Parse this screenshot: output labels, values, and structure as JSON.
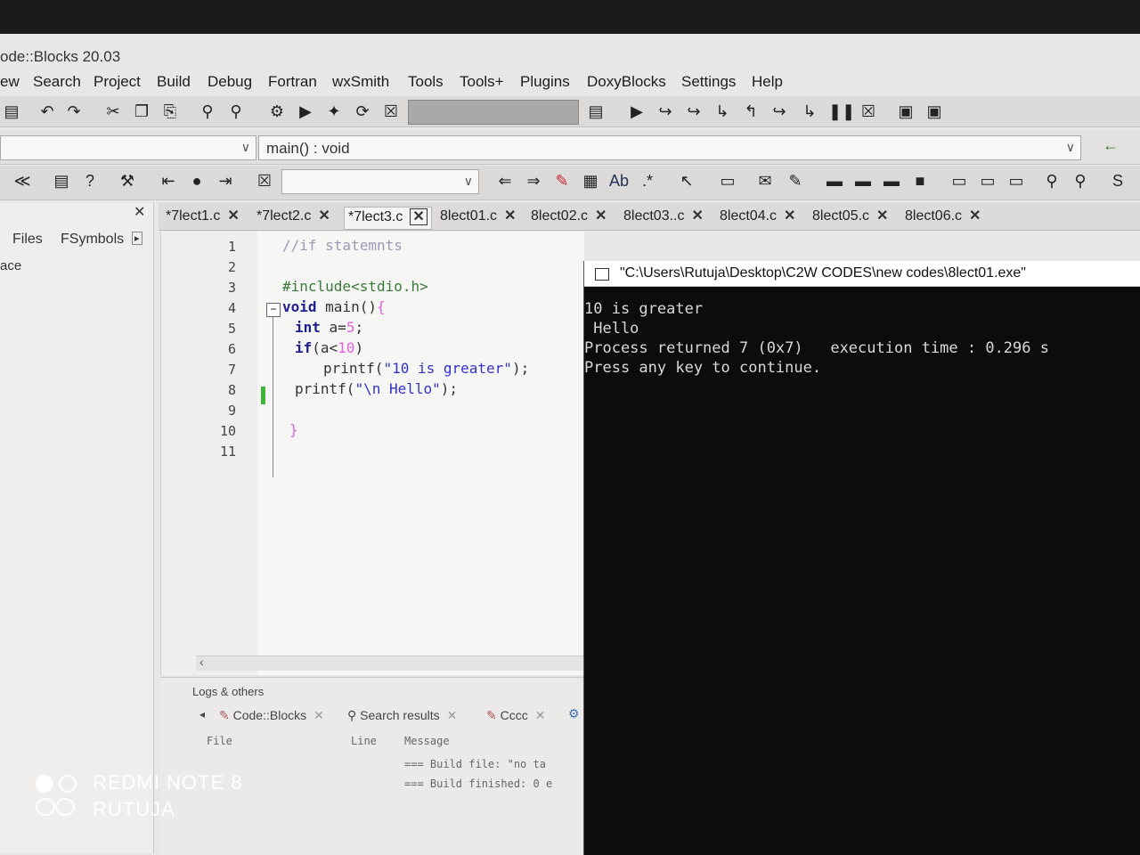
{
  "app_title": "ode::Blocks 20.03",
  "menu": [
    "ew",
    "Search",
    "Project",
    "Build",
    "Debug",
    "Fortran",
    "wxSmith",
    "Tools",
    "Tools+",
    "Plugins",
    "DoxyBlocks",
    "Settings",
    "Help"
  ],
  "function_combo": "main() : void",
  "search_combo": "",
  "side_panel": {
    "tabs": [
      "Files",
      "FSymbols"
    ],
    "item": "ace"
  },
  "tabs": [
    {
      "label": "*7lect1.c"
    },
    {
      "label": "*7lect2.c"
    },
    {
      "label": "*7lect3.c"
    },
    {
      "label": "8lect01.c"
    },
    {
      "label": "8lect02.c"
    },
    {
      "label": "8lect03..c"
    },
    {
      "label": "8lect04.c"
    },
    {
      "label": "8lect05.c"
    },
    {
      "label": "8lect06.c"
    }
  ],
  "editor": {
    "line_numbers": [
      "1",
      "2",
      "3",
      "4",
      "5",
      "6",
      "7",
      "8",
      "9",
      "10",
      "11"
    ],
    "lines": {
      "l1": "//if statemnts",
      "l3": "#include<stdio.h>",
      "l4_kw": "void",
      "l4_rest": " main()",
      "l4_brace": "{",
      "l5_kw": "int",
      "l5_rest": " a=",
      "l5_num": "5",
      "l5_end": ";",
      "l6_kw": "if",
      "l6_rest": "(a<",
      "l6_num": "10",
      "l6_end": ")",
      "l7_fn": "printf(",
      "l7_str": "\"10 is greater\"",
      "l7_end": ");",
      "l8_fn": "printf(",
      "l8_str": "\"\\n Hello\"",
      "l8_end": ");",
      "l10": "}"
    }
  },
  "logs": {
    "title": "Logs & others",
    "tabs": [
      "Code::Blocks",
      "Search results",
      "Cccc"
    ],
    "columns": [
      "File",
      "Line",
      "Message"
    ],
    "messages": [
      "=== Build file: \"no ta",
      "=== Build finished: 0 e"
    ]
  },
  "console": {
    "title": "\"C:\\Users\\Rutuja\\Desktop\\C2W CODES\\new codes\\8lect01.exe\"",
    "lines": [
      "10 is greater",
      " Hello",
      "Process returned 7 (0x7)   execution time : 0.296 s",
      "Press any key to continue."
    ]
  },
  "watermark": {
    "line1": "REDMI NOTE 8",
    "line2": "RUTUJA"
  },
  "colors": {
    "console_bg": "#0c0c0c",
    "console_text": "#d8d8d8",
    "ide_bg": "#e9e7e6"
  }
}
